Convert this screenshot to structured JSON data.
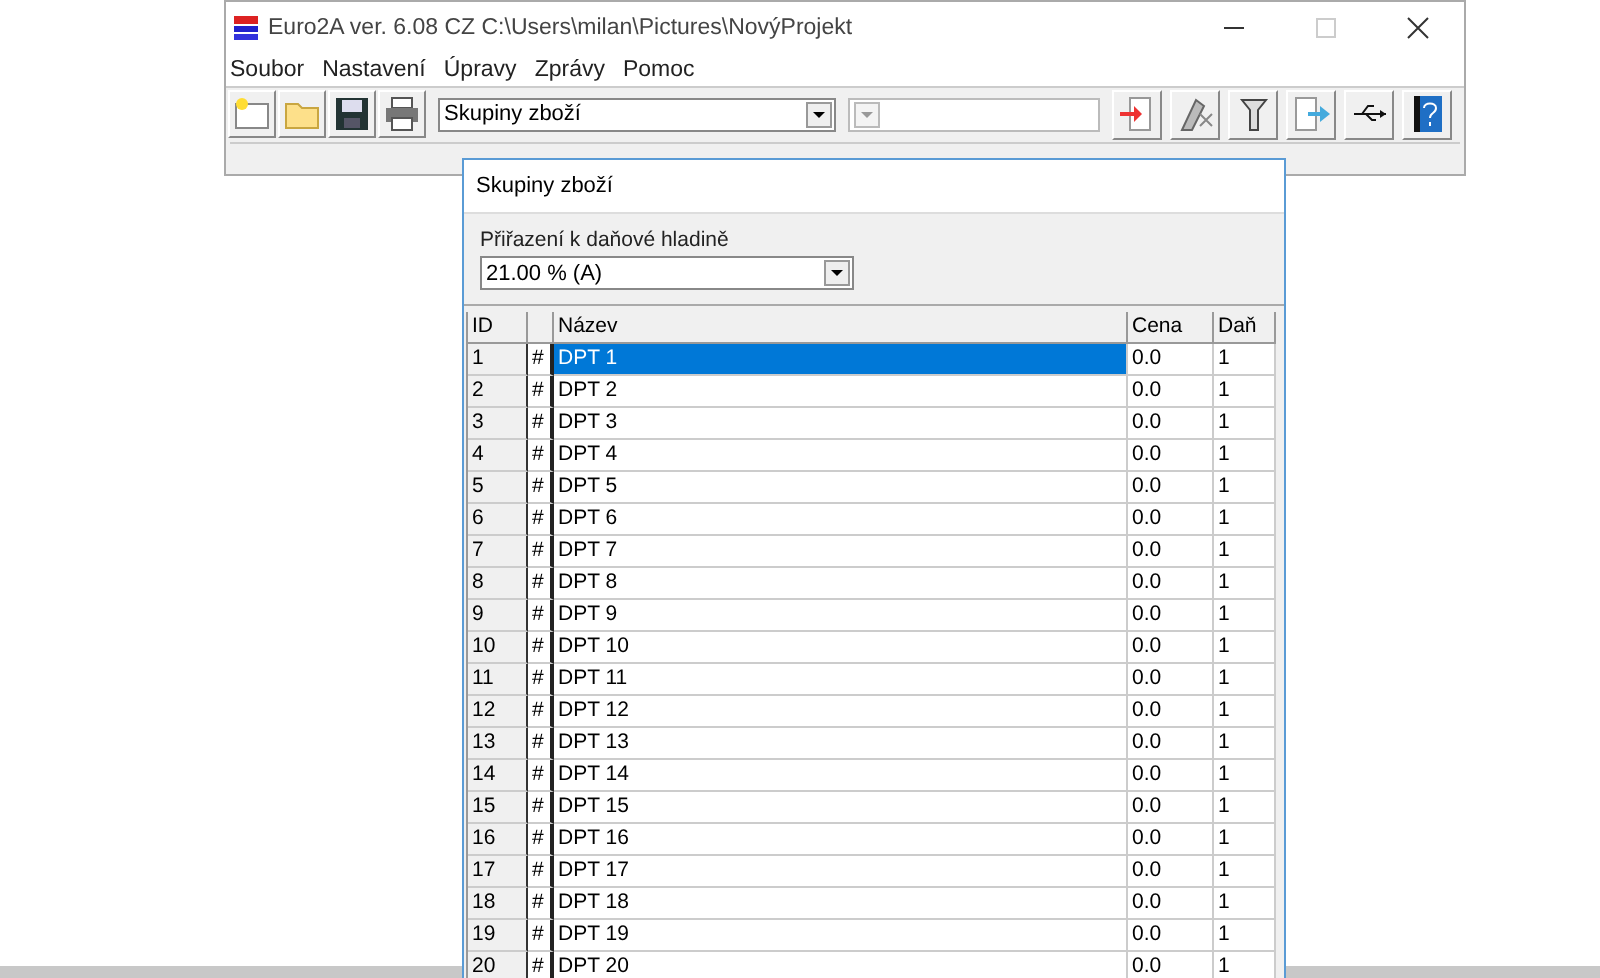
{
  "window": {
    "title": "Euro2A ver. 6.08 CZ   C:\\Users\\milan\\Pictures\\NovýProjekt"
  },
  "menu": [
    "Soubor",
    "Nastavení",
    "Úpravy",
    "Zprávy",
    "Pomoc"
  ],
  "toolbar": {
    "combo": "Skupiny zboží"
  },
  "dialog": {
    "title": "Skupiny zboží",
    "tax_label": "Přiřazení k daňové hladině",
    "tax_value": "21.00 % (A)",
    "columns": [
      "ID",
      "Název",
      "Cena",
      "Daň"
    ],
    "rows": [
      {
        "id": "1",
        "mark": "#",
        "name": "DPT 1",
        "price": "0.0",
        "tax": "1",
        "selected": true
      },
      {
        "id": "2",
        "mark": "#",
        "name": "DPT 2",
        "price": "0.0",
        "tax": "1",
        "selected": false
      },
      {
        "id": "3",
        "mark": "#",
        "name": "DPT 3",
        "price": "0.0",
        "tax": "1",
        "selected": false
      },
      {
        "id": "4",
        "mark": "#",
        "name": "DPT 4",
        "price": "0.0",
        "tax": "1",
        "selected": false
      },
      {
        "id": "5",
        "mark": "#",
        "name": "DPT 5",
        "price": "0.0",
        "tax": "1",
        "selected": false
      },
      {
        "id": "6",
        "mark": "#",
        "name": "DPT 6",
        "price": "0.0",
        "tax": "1",
        "selected": false
      },
      {
        "id": "7",
        "mark": "#",
        "name": "DPT 7",
        "price": "0.0",
        "tax": "1",
        "selected": false
      },
      {
        "id": "8",
        "mark": "#",
        "name": "DPT 8",
        "price": "0.0",
        "tax": "1",
        "selected": false
      },
      {
        "id": "9",
        "mark": "#",
        "name": "DPT 9",
        "price": "0.0",
        "tax": "1",
        "selected": false
      },
      {
        "id": "10",
        "mark": "#",
        "name": "DPT 10",
        "price": "0.0",
        "tax": "1",
        "selected": false
      },
      {
        "id": "11",
        "mark": "#",
        "name": "DPT 11",
        "price": "0.0",
        "tax": "1",
        "selected": false
      },
      {
        "id": "12",
        "mark": "#",
        "name": "DPT 12",
        "price": "0.0",
        "tax": "1",
        "selected": false
      },
      {
        "id": "13",
        "mark": "#",
        "name": "DPT 13",
        "price": "0.0",
        "tax": "1",
        "selected": false
      },
      {
        "id": "14",
        "mark": "#",
        "name": "DPT 14",
        "price": "0.0",
        "tax": "1",
        "selected": false
      },
      {
        "id": "15",
        "mark": "#",
        "name": "DPT 15",
        "price": "0.0",
        "tax": "1",
        "selected": false
      },
      {
        "id": "16",
        "mark": "#",
        "name": "DPT 16",
        "price": "0.0",
        "tax": "1",
        "selected": false
      },
      {
        "id": "17",
        "mark": "#",
        "name": "DPT 17",
        "price": "0.0",
        "tax": "1",
        "selected": false
      },
      {
        "id": "18",
        "mark": "#",
        "name": "DPT 18",
        "price": "0.0",
        "tax": "1",
        "selected": false
      },
      {
        "id": "19",
        "mark": "#",
        "name": "DPT 19",
        "price": "0.0",
        "tax": "1",
        "selected": false
      },
      {
        "id": "20",
        "mark": "#",
        "name": "DPT 20",
        "price": "0.0",
        "tax": "1",
        "selected": false
      }
    ]
  }
}
